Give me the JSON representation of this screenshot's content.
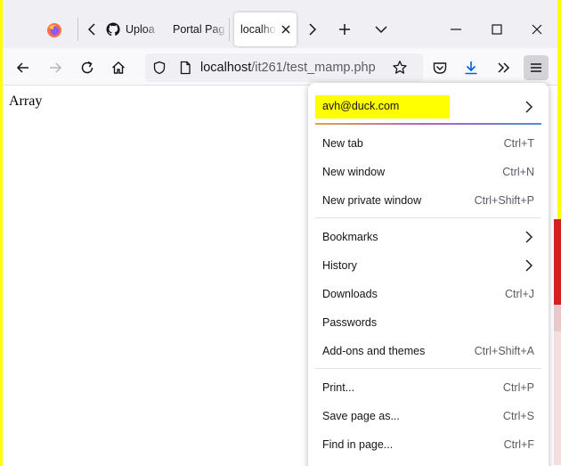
{
  "tabs": [
    {
      "label": "Uploa"
    },
    {
      "label": "Portal Pag"
    },
    {
      "label": "localho"
    }
  ],
  "address": {
    "host": "localhost",
    "path": "/it261/test_mamp.php"
  },
  "page": {
    "text": "Array"
  },
  "menu": {
    "account_email": "avh@duck.com",
    "group1": [
      {
        "label": "New tab",
        "shortcut": "Ctrl+T"
      },
      {
        "label": "New window",
        "shortcut": "Ctrl+N"
      },
      {
        "label": "New private window",
        "shortcut": "Ctrl+Shift+P"
      }
    ],
    "group2": [
      {
        "label": "Bookmarks",
        "shortcut": ""
      },
      {
        "label": "History",
        "shortcut": ""
      },
      {
        "label": "Downloads",
        "shortcut": "Ctrl+J"
      },
      {
        "label": "Passwords",
        "shortcut": ""
      },
      {
        "label": "Add-ons and themes",
        "shortcut": "Ctrl+Shift+A"
      }
    ],
    "group3": [
      {
        "label": "Print...",
        "shortcut": "Ctrl+P"
      },
      {
        "label": "Save page as...",
        "shortcut": "Ctrl+S"
      },
      {
        "label": "Find in page...",
        "shortcut": "Ctrl+F"
      }
    ]
  },
  "colors": {
    "highlight": "#ffff00",
    "download_arrow": "#0060df",
    "firefox_orange": "#ff7139"
  }
}
